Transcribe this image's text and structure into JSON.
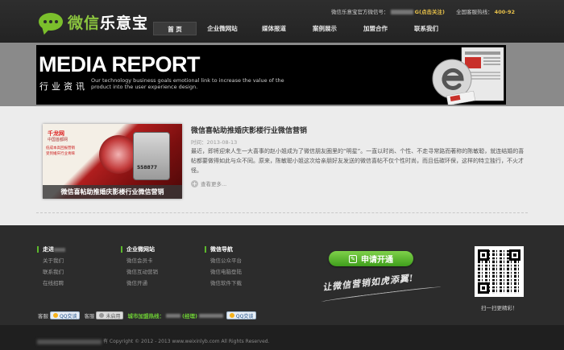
{
  "brand": {
    "name_part1": "微信",
    "name_part2": "乐意宝"
  },
  "top_info": {
    "wechat_label": "微信乐意宝官方微信号：",
    "wechat_hint": "G(点击关注)",
    "hotline_label": "全国客服热线：",
    "hotline_value": "400-92"
  },
  "nav": {
    "items": [
      {
        "label": "首 页",
        "active": true
      },
      {
        "label": "企业微网站",
        "active": false
      },
      {
        "label": "媒体报道",
        "active": false
      },
      {
        "label": "案例展示",
        "active": false
      },
      {
        "label": "加盟合作",
        "active": false
      },
      {
        "label": "联系我们",
        "active": false
      }
    ]
  },
  "banner": {
    "title": "MEDIA REPORT",
    "subtitle_cn": "行业资讯",
    "tagline": "Our technology business goals emotional link to increase the value of the product into the user experience design."
  },
  "article": {
    "image_caption": "微信喜帖助推婚庆影楼行业微信营销",
    "image_logo": "千龙网",
    "image_logo_sub": "中国首都网",
    "image_ad_line1": "低成本高回报营销",
    "image_ad_line2": "受到婚庆行业青睐",
    "image_phone_text": "558877",
    "title": "微信喜帖助推婚庆影楼行业微信营销",
    "date_label": "时间：",
    "date": "2013-08-13",
    "body": "最近，即将迎来人生一大喜事的赵小姐成为了微信朋友圈里的“明星”。一直以时尚、个性、不走寻常路而著称的陈敏聪，就连结婚的喜帖都要做得如此与众不同。原来，陈敏聪小姐这次给亲朋好友发送的微信喜帖不仅个性时尚，而且低碳环保，这样的特立独行，不火才怪。",
    "more_label": "查看更多..."
  },
  "footer": {
    "columns": [
      {
        "title": "走进",
        "links": [
          "关于我们",
          "联系我们",
          "在线招聘"
        ]
      },
      {
        "title": "企业微网站",
        "links": [
          "微信会员卡",
          "微信互动营销",
          "微信开通"
        ]
      },
      {
        "title": "微信导航",
        "links": [
          "微信公众平台",
          "微信电脑登陆",
          "微信软件下载"
        ]
      }
    ],
    "cta_label": "申请开通",
    "slogan": "让微信营销如虎添翼!",
    "qr_caption": "扫一扫更精彩！",
    "service": {
      "label1": "客服",
      "qq_online": "QQ交谈",
      "label2": "客服",
      "qq_offline": "未启用",
      "hotline_label": "城市加盟热线：",
      "hotline_value": "(经理)",
      "qq_last": "QQ交谈"
    },
    "copyright": "有 Copyright © 2012 - 2013 www.weixinlyb.com All Rights Reserved."
  },
  "colors": {
    "accent_green": "#8cc63f",
    "header_bg": "#262626",
    "footer_bg": "#2c2c2c"
  }
}
